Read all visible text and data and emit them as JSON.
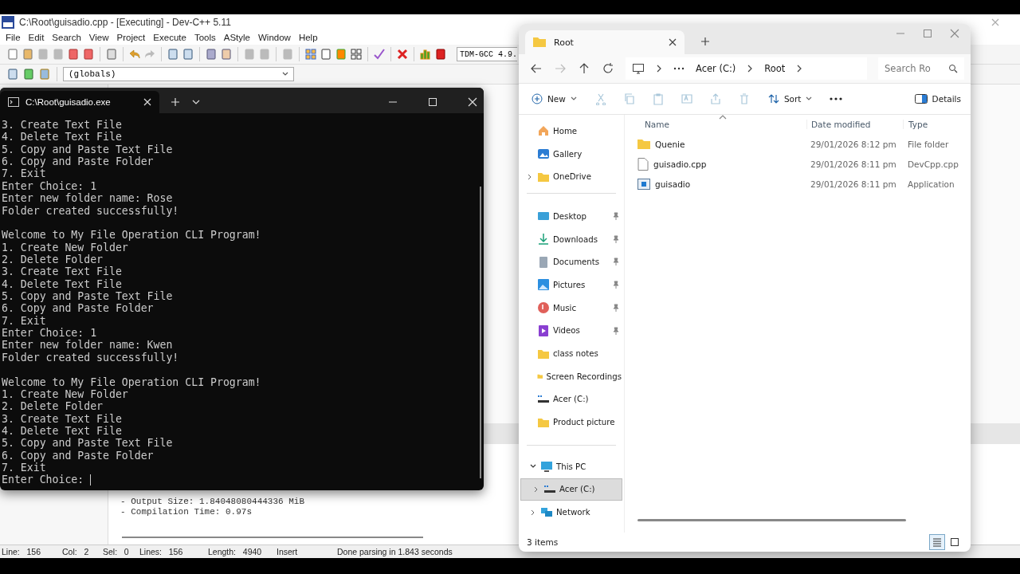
{
  "devcpp": {
    "title": "C:\\Root\\guisadio.cpp - [Executing] - Dev-C++ 5.11",
    "menu": [
      "File",
      "Edit",
      "Search",
      "View",
      "Project",
      "Execute",
      "Tools",
      "AStyle",
      "Window",
      "Help"
    ],
    "compiler": "TDM-GCC 4.9.",
    "scope": "(globals)",
    "log": [
      "- Output Size: 1.84048080444336 MiB",
      "- Compilation Time: 0.97s"
    ],
    "status_bar": [
      {
        "label": "Line:",
        "value": "156"
      },
      {
        "label": "Col:",
        "value": "2"
      },
      {
        "label": "Sel:",
        "value": "0"
      },
      {
        "label": "Lines:",
        "value": "156"
      },
      {
        "label": "Length:",
        "value": "4940"
      },
      {
        "label": "Insert"
      },
      {
        "label": "Done parsing in 1.843 seconds"
      }
    ]
  },
  "terminal": {
    "tab": "C:\\Root\\guisadio.exe",
    "blocks": [
      [
        "3. Create Text File",
        "4. Delete Text File",
        "5. Copy and Paste Text File",
        "6. Copy and Paste Folder",
        "7. Exit",
        "Enter Choice: 1",
        "Enter new folder name: Rose",
        "Folder created successfully!"
      ],
      [
        "Welcome to My File Operation CLI Program!",
        "1. Create New Folder",
        "2. Delete Folder",
        "3. Create Text File",
        "4. Delete Text File",
        "5. Copy and Paste Text File",
        "6. Copy and Paste Folder",
        "7. Exit",
        "Enter Choice: 1",
        "Enter new folder name: Kwen",
        "Folder created successfully!"
      ],
      [
        "Welcome to My File Operation CLI Program!",
        "1. Create New Folder",
        "2. Delete Folder",
        "3. Create Text File",
        "4. Delete Text File",
        "5. Copy and Paste Text File",
        "6. Copy and Paste Folder",
        "7. Exit",
        "Enter Choice:"
      ]
    ]
  },
  "explorer": {
    "tabs": [
      {
        "label": "Root",
        "selected": true
      }
    ],
    "breadcrumb": [
      "Acer (C:)",
      "Root"
    ],
    "search": {
      "placeholder": "Search Ro"
    },
    "commands": {
      "new": "New",
      "sort": "Sort",
      "details": "Details"
    },
    "sidebar": [
      {
        "items": [
          {
            "label": "Home",
            "kind": "home",
            "pinned": false,
            "expandable": false
          },
          {
            "label": "Gallery",
            "kind": "gallery",
            "pinned": false,
            "expandable": false
          },
          {
            "label": "OneDrive",
            "kind": "folder",
            "pinned": false,
            "expandable": true
          }
        ]
      },
      {
        "items": [
          {
            "label": "Desktop",
            "kind": "desktop",
            "pinned": true,
            "expandable": false
          },
          {
            "label": "Downloads",
            "kind": "download",
            "pinned": true,
            "expandable": false
          },
          {
            "label": "Documents",
            "kind": "documents",
            "pinned": true,
            "expandable": false
          },
          {
            "label": "Pictures",
            "kind": "pictures",
            "pinned": true,
            "expandable": false
          },
          {
            "label": "Music",
            "kind": "music",
            "pinned": true,
            "expandable": false
          },
          {
            "label": "Videos",
            "kind": "videos",
            "pinned": true,
            "expandable": false
          },
          {
            "label": "class notes",
            "kind": "folder",
            "pinned": false,
            "expandable": false
          },
          {
            "label": "Screen Recordings",
            "kind": "folder",
            "pinned": false,
            "expandable": false
          },
          {
            "label": "Acer (C:)",
            "kind": "drive",
            "pinned": false,
            "expandable": false
          },
          {
            "label": "Product picture",
            "kind": "folder",
            "pinned": false,
            "expandable": false
          }
        ]
      },
      {
        "tree": [
          {
            "label": "This PC",
            "kind": "pc",
            "expanded": true,
            "selected": false,
            "children": [
              {
                "label": "Acer (C:)",
                "kind": "drive",
                "expanded": false,
                "selected": true
              }
            ]
          },
          {
            "label": "Network",
            "kind": "network",
            "expanded": false,
            "selected": false
          }
        ]
      }
    ],
    "columns": [
      "Name",
      "Date modified",
      "Type"
    ],
    "rows": [
      {
        "name": "Quenie",
        "date": "29/01/2026 8:12 pm",
        "type": "File folder",
        "kind": "folder"
      },
      {
        "name": "guisadio.cpp",
        "date": "29/01/2026 8:11 pm",
        "type": "DevCpp.cpp",
        "kind": "file"
      },
      {
        "name": "guisadio",
        "date": "29/01/2026 8:11 pm",
        "type": "Application",
        "kind": "app"
      }
    ],
    "status": "3 items",
    "views": [
      {
        "kind": "details",
        "selected": true
      },
      {
        "kind": "tiles",
        "selected": false
      }
    ]
  }
}
